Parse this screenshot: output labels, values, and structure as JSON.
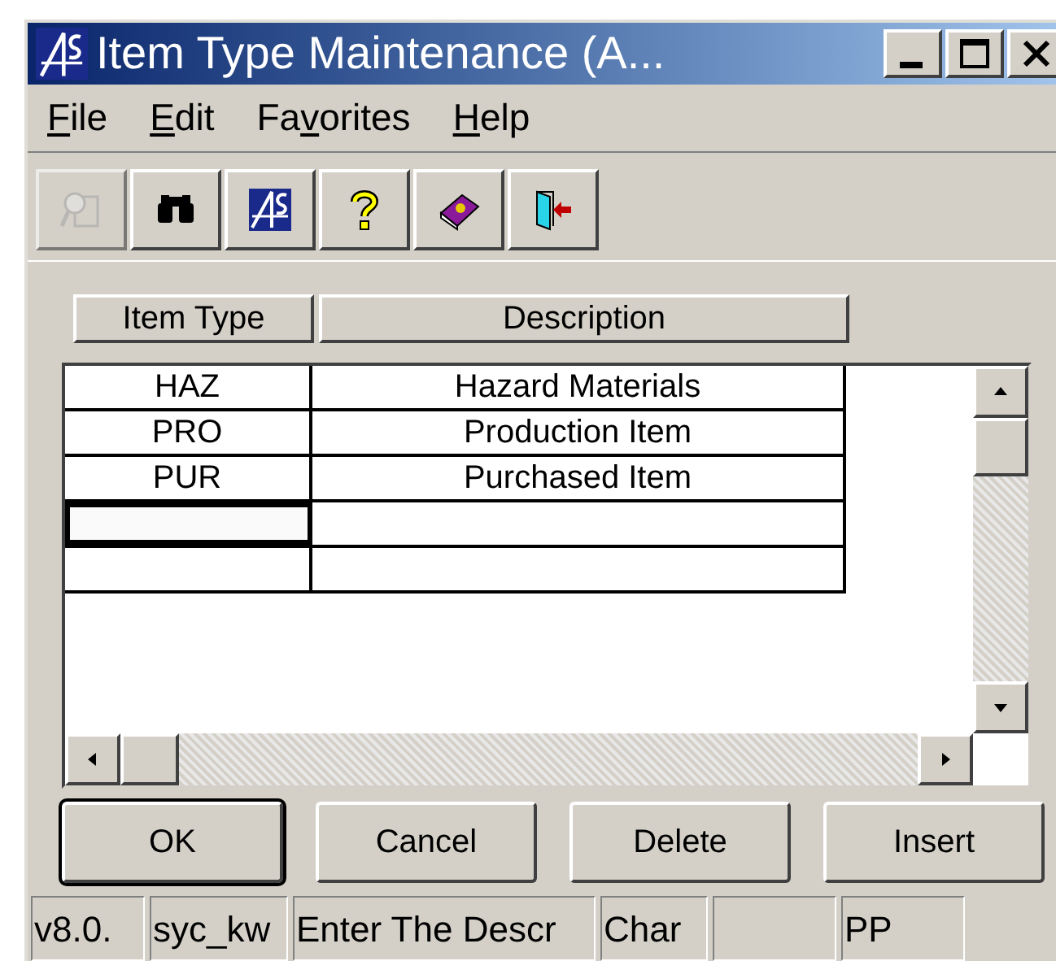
{
  "window": {
    "title": "Item Type Maintenance (A..."
  },
  "menu": [
    {
      "key": "F",
      "after": "ile"
    },
    {
      "key": "E",
      "after": "dit"
    },
    {
      "before": "Fa",
      "key": "v",
      "after": "orites"
    },
    {
      "key": "H",
      "after": "elp"
    }
  ],
  "toolbar": [
    {
      "kind": "search-doc",
      "disabled": true
    },
    {
      "kind": "binoculars",
      "disabled": false
    },
    {
      "kind": "logo",
      "disabled": false
    },
    {
      "kind": "question",
      "disabled": false
    },
    {
      "kind": "book",
      "disabled": false
    },
    {
      "kind": "exit",
      "disabled": false
    }
  ],
  "table": {
    "columns": [
      "Item Type",
      "Description"
    ],
    "rows": [
      {
        "item_type": "HAZ",
        "description": "Hazard Materials",
        "focused": false
      },
      {
        "item_type": "PRO",
        "description": "Production Item",
        "focused": false
      },
      {
        "item_type": "PUR",
        "description": "Purchased Item",
        "focused": false
      },
      {
        "focused": true
      },
      {
        "focused": false
      }
    ]
  },
  "buttons": [
    {
      "label": "OK",
      "default": true
    },
    {
      "label": "Cancel",
      "default": false
    },
    {
      "label": "Delete",
      "default": false
    },
    {
      "label": "Insert",
      "default": false
    }
  ],
  "status_bar": [
    {
      "kind": "text",
      "text": "v8.0."
    },
    {
      "kind": "text",
      "text": "syc_kw"
    },
    {
      "kind": "text",
      "text": "Enter The Descr"
    },
    {
      "kind": "text",
      "text": "Char"
    },
    {
      "kind": "blank"
    },
    {
      "kind": "text",
      "text": "PP"
    }
  ]
}
